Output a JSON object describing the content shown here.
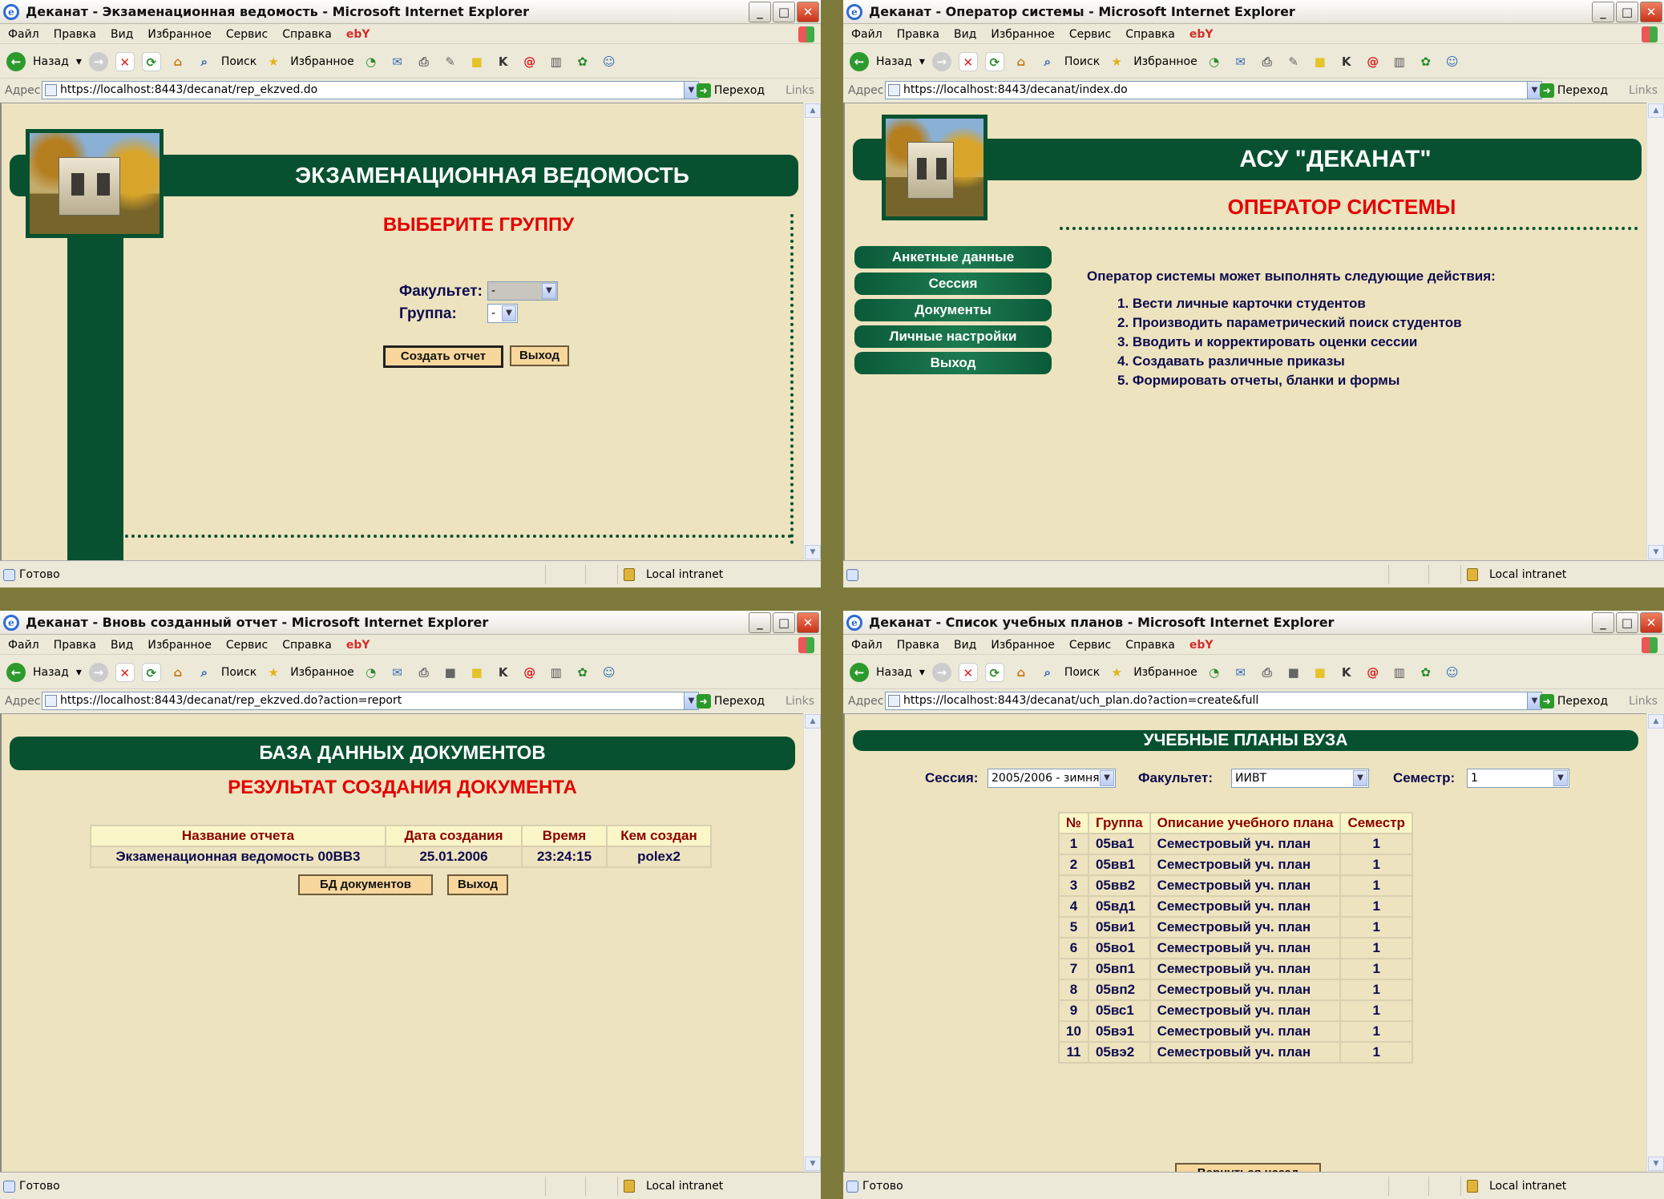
{
  "common": {
    "menu": [
      "Файл",
      "Правка",
      "Вид",
      "Избранное",
      "Сервис",
      "Справка"
    ],
    "toolbar": {
      "back": "Назад",
      "search": "Поиск",
      "favorites": "Избранное"
    },
    "addr_label": "Адрес:",
    "go": "Переход",
    "links": "Links",
    "status_ready": "Готово",
    "zone": "Local intranet"
  },
  "w1": {
    "title": "Деканат - Экзаменационная ведомость - Microsoft Internet Explorer",
    "url": "https://localhost:8443/decanat/rep_ekzved.do",
    "banner": "ЭКЗАМЕНАЦИОННАЯ ВЕДОМОСТЬ",
    "subtitle": "ВЫБЕРИТЕ ГРУППУ",
    "faculty_label": "Факультет:",
    "faculty_value": "-",
    "group_label": "Группа:",
    "group_value": "-",
    "create_btn": "Создать отчет",
    "exit_btn": "Выход"
  },
  "w2": {
    "title": "Деканат - Оператор системы - Microsoft Internet Explorer",
    "url": "https://localhost:8443/decanat/index.do",
    "banner": "АСУ \"ДЕКАНАТ\"",
    "subtitle": "ОПЕРАТОР СИСТЕМЫ",
    "menu": [
      "Анкетные данные",
      "Сессия",
      "Документы",
      "Личные настройки",
      "Выход"
    ],
    "intro": "Оператор системы может выполнять следующие действия:",
    "actions": [
      "1. Вести личные карточки студентов",
      "2. Производить параметрический поиск студентов",
      "3. Вводить и корректировать оценки сессии",
      "4. Создавать различные приказы",
      "5. Формировать отчеты, бланки и формы"
    ]
  },
  "w3": {
    "title": "Деканат - Вновь созданный отчет - Microsoft Internet Explorer",
    "url": "https://localhost:8443/decanat/rep_ekzved.do?action=report",
    "banner": "БАЗА ДАННЫХ ДОКУМЕНТОВ",
    "subtitle": "РЕЗУЛЬТАТ СОЗДАНИЯ ДОКУМЕНТА",
    "headers": [
      "Название отчета",
      "Дата создания",
      "Время",
      "Кем создан"
    ],
    "row": [
      "Экзаменационная ведомость 00ВВ3",
      "25.01.2006",
      "23:24:15",
      "polex2"
    ],
    "db_btn": "БД документов",
    "exit_btn": "Выход"
  },
  "w4": {
    "title": "Деканат - Список учебных планов - Microsoft Internet Explorer",
    "url": "https://localhost:8443/decanat/uch_plan.do?action=create&full",
    "banner": "УЧЕБНЫЕ ПЛАНЫ ВУЗА",
    "session_label": "Сессия:",
    "session_value": "2005/2006 - зимняя",
    "faculty_label": "Факультет:",
    "faculty_value": "ИИВТ",
    "semester_label": "Семестр:",
    "semester_value": "1",
    "headers": [
      "№",
      "Группа",
      "Описание учебного плана",
      "Семестр"
    ],
    "rows": [
      [
        "1",
        "05ва1",
        "Семестровый уч. план",
        "1"
      ],
      [
        "2",
        "05вв1",
        "Семестровый уч. план",
        "1"
      ],
      [
        "3",
        "05вв2",
        "Семестровый уч. план",
        "1"
      ],
      [
        "4",
        "05вд1",
        "Семестровый уч. план",
        "1"
      ],
      [
        "5",
        "05ви1",
        "Семестровый уч. план",
        "1"
      ],
      [
        "6",
        "05во1",
        "Семестровый уч. план",
        "1"
      ],
      [
        "7",
        "05вп1",
        "Семестровый уч. план",
        "1"
      ],
      [
        "8",
        "05вп2",
        "Семестровый уч. план",
        "1"
      ],
      [
        "9",
        "05вс1",
        "Семестровый уч. план",
        "1"
      ],
      [
        "10",
        "05вэ1",
        "Семестровый уч. план",
        "1"
      ],
      [
        "11",
        "05вэ2",
        "Семестровый уч. план",
        "1"
      ]
    ],
    "back_btn": "Вернуться назад"
  }
}
